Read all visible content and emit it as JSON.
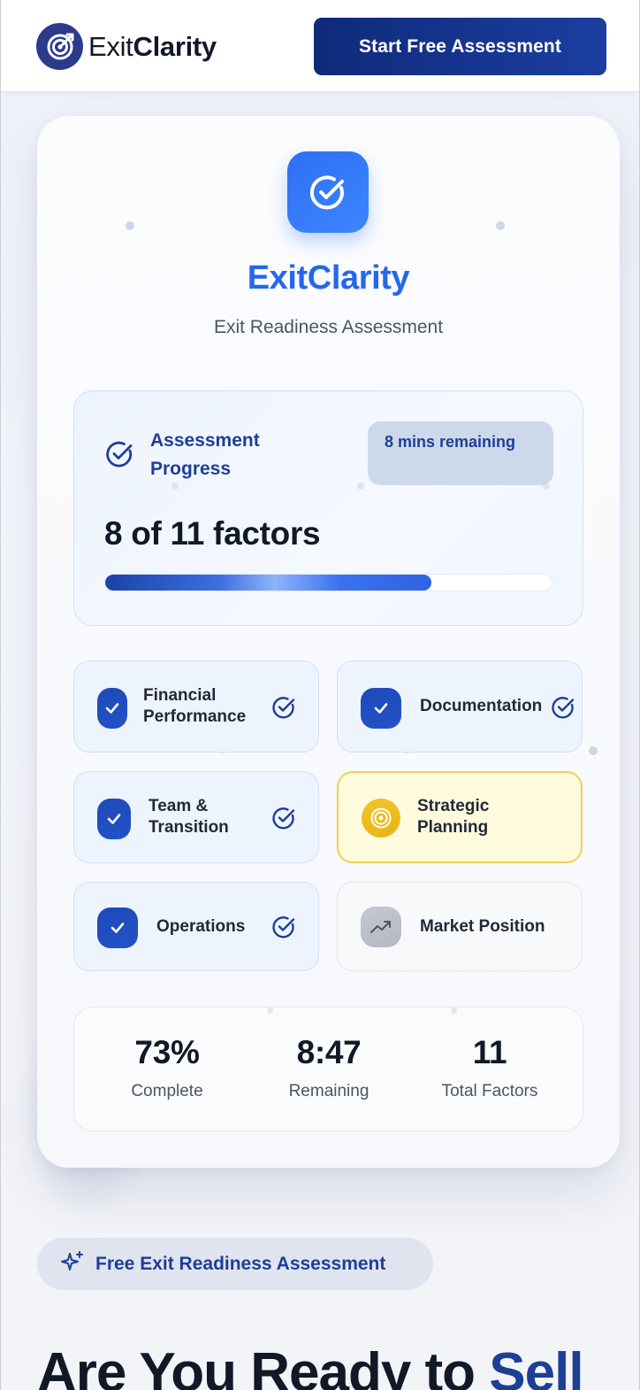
{
  "header": {
    "logo_light": "Exit",
    "logo_bold": "Clarity",
    "cta_label": "Start Free Assessment"
  },
  "card": {
    "title": "ExitClarity",
    "subtitle": "Exit Readiness Assessment",
    "progress": {
      "label": "Assessment Progress",
      "time_badge": "8 mins remaining",
      "factors_text": "8 of 11 factors",
      "fill_fraction": 0.73
    },
    "factors": [
      {
        "label": "Financial Performance",
        "status": "complete"
      },
      {
        "label": "Documentation",
        "status": "complete"
      },
      {
        "label": "Team & Transition",
        "status": "complete"
      },
      {
        "label": "Strategic Planning",
        "status": "in-progress"
      },
      {
        "label": "Operations",
        "status": "complete"
      },
      {
        "label": "Market Position",
        "status": "pending"
      }
    ],
    "stats": [
      {
        "value": "73%",
        "label": "Complete"
      },
      {
        "value": "8:47",
        "label": "Remaining"
      },
      {
        "value": "11",
        "label": "Total Factors"
      }
    ]
  },
  "promo": {
    "pill_label": "Free Exit Readiness Assessment",
    "heading_main": "Are You Ready to ",
    "heading_accent": "Sell"
  },
  "colors": {
    "brand_navy": "#1d3f96",
    "brand_blue": "#2667ea",
    "active_gold": "#f2c52b",
    "complete_badge": "#1e4ab8"
  },
  "icons": {
    "logo": "target-arrow-icon",
    "app": "check-circle-icon",
    "progress": "check-circle-icon",
    "complete": "check-circle-icon",
    "in_progress": "target-icon",
    "pending": "trend-up-icon",
    "pill": "sparkles-icon"
  }
}
